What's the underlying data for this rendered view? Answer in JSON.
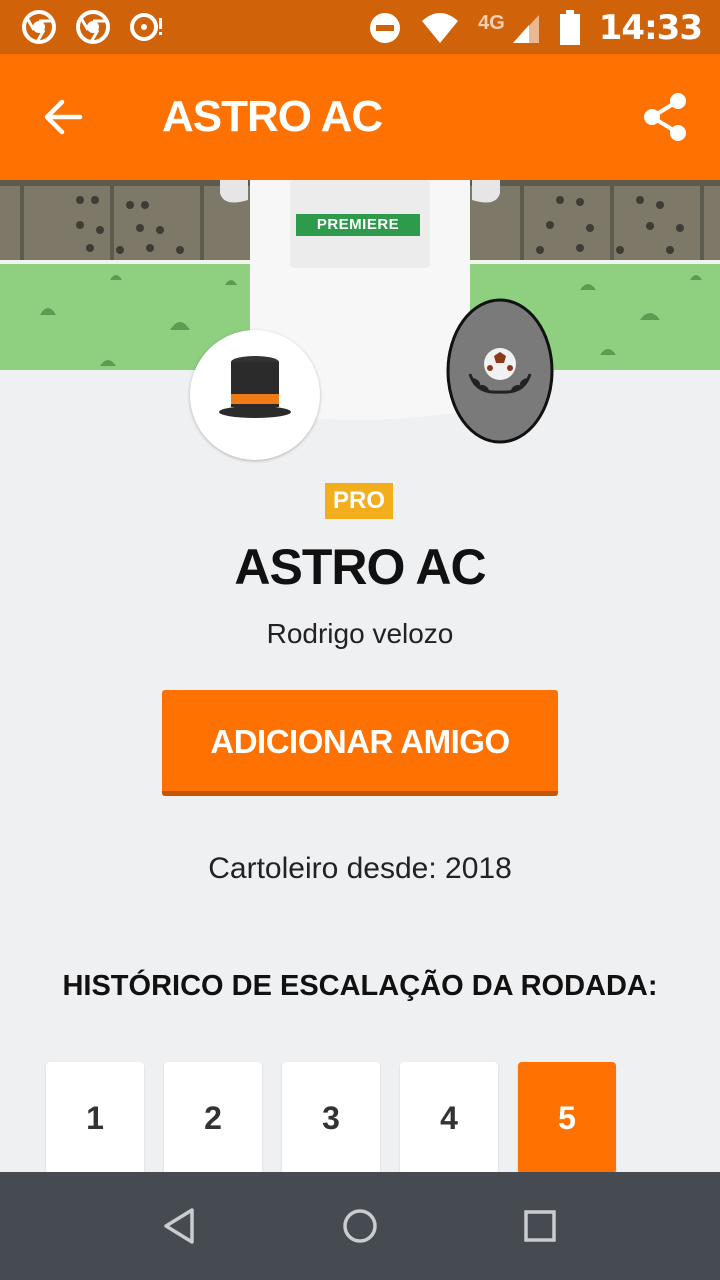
{
  "status_bar": {
    "time": "14:33",
    "network": "4G",
    "notifications": [
      "chrome-icon",
      "chrome-icon",
      "disc-alert-icon"
    ],
    "system_icons": [
      "do-not-disturb-icon",
      "wifi-icon",
      "signal-icon",
      "battery-icon"
    ]
  },
  "app_bar": {
    "title": "ASTRO AC",
    "back_icon": "arrow-left-icon",
    "share_icon": "share-icon"
  },
  "profile": {
    "shirt_sponsor": "PREMIERE",
    "badge": "PRO",
    "team_name": "ASTRO AC",
    "owner_name": "Rodrigo velozo",
    "add_friend_label": "ADICIONAR AMIGO",
    "member_since": "Cartoleiro desde: 2018"
  },
  "history": {
    "title": "HISTÓRICO DE ESCALAÇÃO DA RODADA:",
    "rounds": [
      "1",
      "2",
      "3",
      "4",
      "5"
    ],
    "selected_round": "5"
  },
  "colors": {
    "primary": "#ff7100",
    "status_bar": "#d0620a",
    "background": "#eff0f2",
    "pro_badge": "#f2ae1c",
    "nav_bar": "#454b51"
  }
}
